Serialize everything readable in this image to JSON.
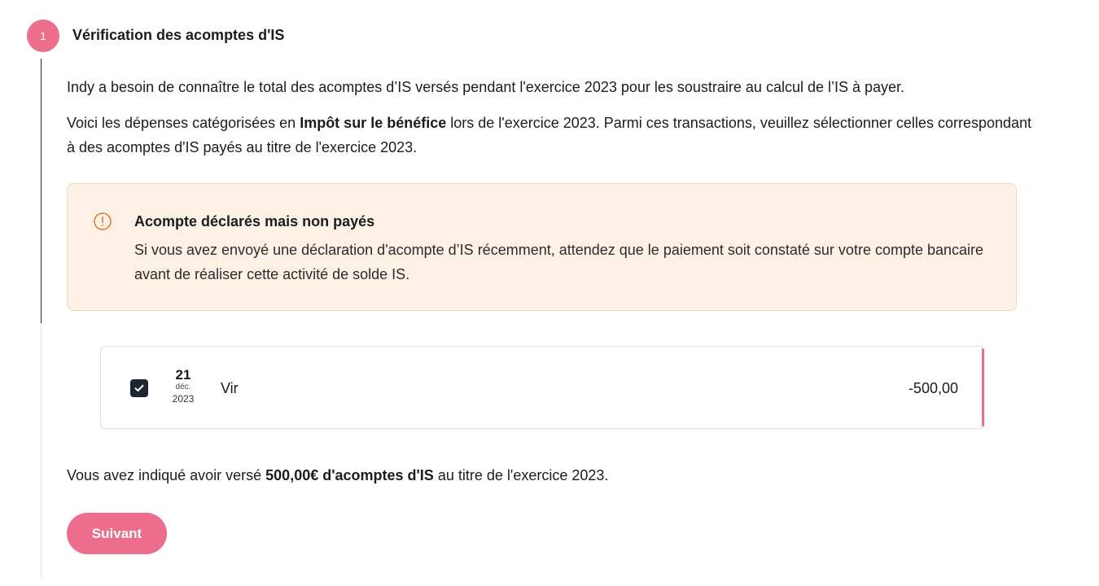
{
  "step": {
    "number": "1",
    "title": "Vérification des acomptes d'IS"
  },
  "intro": {
    "para1": "Indy a besoin de connaître le total des acomptes d’IS versés pendant l'exercice 2023 pour les soustraire au calcul de l’IS à payer.",
    "para2_before": "Voici les dépenses catégorisées en ",
    "para2_bold": "Impôt sur le bénéfice",
    "para2_after": " lors de l'exercice 2023. Parmi ces transactions, veuillez sélectionner celles correspondant à des acomptes d'IS payés au titre de l'exercice 2023."
  },
  "alert": {
    "icon": "exclamation-circle-icon",
    "title": "Acompte déclarés mais non payés",
    "body": "Si vous avez envoyé une déclaration d'acompte d’IS récemment, attendez que le paiement soit constaté sur votre compte bancaire avant de réaliser cette activité de solde IS.",
    "color": "#e07a2f"
  },
  "transactions": [
    {
      "checked": true,
      "day": "21",
      "month": "déc.",
      "year": "2023",
      "label": "Vir",
      "amount": "-500,00"
    }
  ],
  "summary": {
    "before": "Vous avez indiqué avoir versé ",
    "bold": "500,00€ d'acomptes d'IS",
    "after": " au titre de l'exercice 2023."
  },
  "buttons": {
    "next_label": "Suivant"
  },
  "colors": {
    "accent": "#ec6d8c",
    "alert_bg": "#fdf1e6",
    "checkbox": "#1f2530"
  }
}
